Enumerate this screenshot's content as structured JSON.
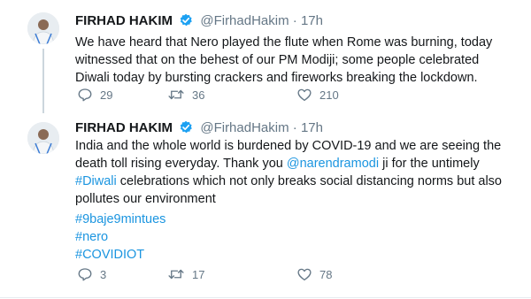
{
  "tweets": [
    {
      "name": "FIRHAD HAKIM",
      "handle": "@FirhadHakim",
      "dot": "·",
      "time": "17h",
      "text_lines": [
        "We have heard that Nero played the flute when Rome was burning, today",
        "witnessed that on the behest of our PM Modiji; some people celebrated",
        "Diwali today by bursting crackers and fireworks breaking the lockdown."
      ],
      "replies": "29",
      "retweets": "36",
      "likes": "210"
    },
    {
      "name": "FIRHAD HAKIM",
      "handle": "@FirhadHakim",
      "dot": "·",
      "time": "17h",
      "line1": "India and the whole world is burdened by COVID-19 and we are seeing the",
      "line2_pre": "death toll rising everyday. Thank you ",
      "mention": "@narendramodi",
      "line2_post": " ji for the untimely",
      "hashtag_diwali": "#Diwali",
      "line3_post": " celebrations which not only breaks social distancing norms but also",
      "line4": "pollutes our environment",
      "hashtags": [
        "#9baje9mintues",
        "#nero",
        "#COVIDIOT"
      ],
      "replies": "3",
      "retweets": "17",
      "likes": "78"
    }
  ],
  "colors": {
    "link": "#1b95e0",
    "verified": "#1da1f2",
    "meta": "#657786"
  },
  "icons": [
    "verified-badge-icon",
    "reply-icon",
    "retweet-icon",
    "like-icon"
  ]
}
